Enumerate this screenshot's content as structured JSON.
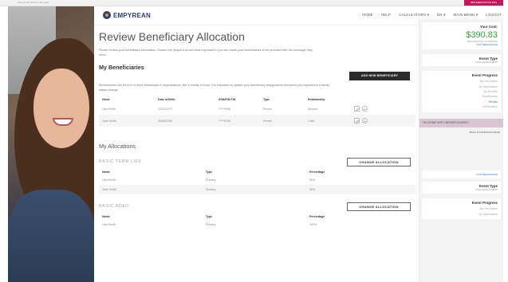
{
  "topbar": {
    "crumb": "Viewing Beneficiary Allocation",
    "env": "IMPLEMENTATION ENV"
  },
  "brand": {
    "name": "EMPYREAN"
  },
  "nav": [
    "HOME",
    "HELP",
    "CALCULATORS ▾",
    "EN ▾",
    "MAIN MENU ▾",
    "LOGOUT"
  ],
  "page": {
    "title": "Review Beneficiary Allocation",
    "intro": "Please review your beneficiary information. Ensure the people that are most important to you are made your beneficiaries to be provided with the coverage they need."
  },
  "beneficiaries": {
    "title": "My Beneficiaries",
    "add_button": "ADD NEW BENEFICIARY",
    "desc": "Beneficiaries can be one or more individuals or organizations, like a charity or trust. It is important to update your beneficiary designations whenever you experience a family status change.",
    "columns": [
      "Name",
      "Date of Birth",
      "SSN/EID/TIN",
      "Type",
      "Relationship"
    ],
    "rows": [
      {
        "name": "Lisa Smith",
        "dob": "12/12/1972",
        "ssn": "*****3456",
        "type": "Person",
        "relationship": "Spouse"
      },
      {
        "name": "Jane Smith",
        "dob": "06/06/2006",
        "ssn": "*****6789",
        "type": "Person",
        "relationship": "Child"
      }
    ]
  },
  "allocations": {
    "title": "My Allocations",
    "groups": [
      {
        "name": "BASIC TERM LIFE",
        "button": "CHANGE ALLOCATION",
        "columns": [
          "Name",
          "Type",
          "Percentage"
        ],
        "rows": [
          {
            "name": "Lisa Smith",
            "type": "Primary",
            "pct": "50%"
          },
          {
            "name": "Jane Smith",
            "type": "Primary",
            "pct": "50%"
          }
        ]
      },
      {
        "name": "BASIC AD&D",
        "button": "CHANGE ALLOCATION",
        "columns": [
          "Name",
          "Type",
          "Percentage"
        ],
        "rows": [
          {
            "name": "Lisa Smith",
            "type": "Primary",
            "pct": "100%"
          }
        ]
      }
    ]
  },
  "sidebar": {
    "cost_label": "Your Cost:",
    "cost_value": "$390.83",
    "cost_freq": "SEMI-MONTHLY (24 PERIOD)",
    "cost_link": "COST BREAKDOWN",
    "event_type_label": "Event Type",
    "event_type_value": "OPEN ENROLLMENT",
    "progress_label": "Event Progress",
    "progress_steps": [
      "My Information",
      "My Dependents",
      "My Benefits",
      "Beneficiaries",
      "Review",
      "Confirmation"
    ],
    "active_step_index": 4,
    "done_button": "I'M DONE WITH BENEFICIARIES",
    "back_link": "BACK TO PREVIOUS PAGE",
    "cost_link_2": "COST BREAKDOWN",
    "event_type_label_2": "Event Type",
    "event_type_value_2": "OPEN ENROLLMENT",
    "progress_label_2": "Event Progress",
    "progress_steps_2": [
      "My Information",
      "My Dependents"
    ]
  }
}
